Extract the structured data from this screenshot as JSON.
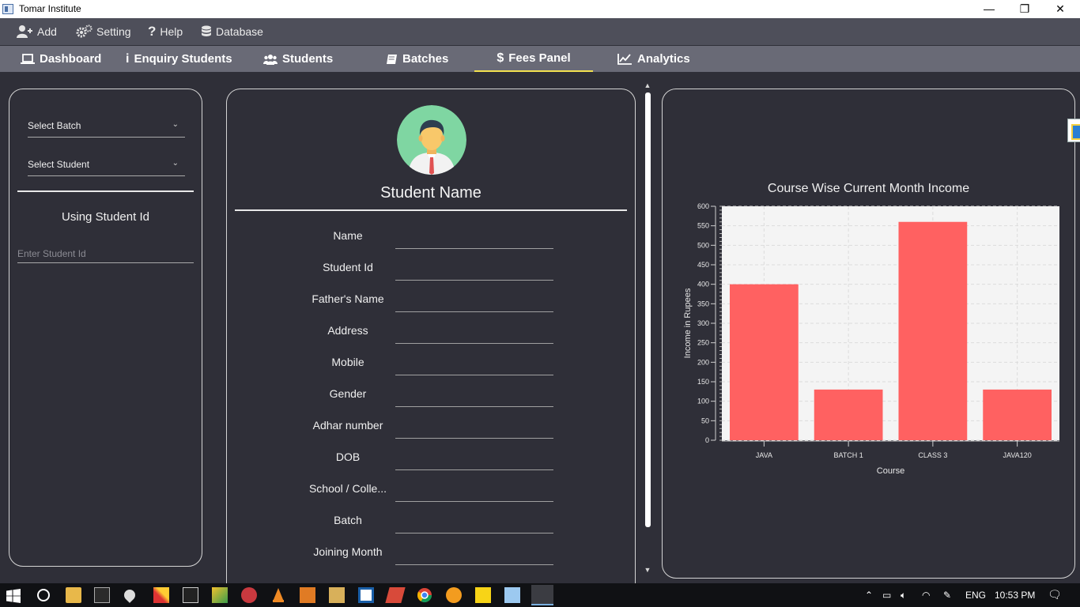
{
  "window": {
    "title": "Tomar Institute",
    "minimize": "—",
    "restore": "❐",
    "close": "✕"
  },
  "menu": [
    {
      "label": "Add",
      "icon": "add-user-icon"
    },
    {
      "label": "Setting",
      "icon": "gears-icon"
    },
    {
      "label": "Help",
      "icon": "question-icon"
    },
    {
      "label": "Database",
      "icon": "database-icon"
    }
  ],
  "tabs": [
    {
      "label": "Dashboard",
      "icon": "laptop-icon"
    },
    {
      "label": "Enquiry Students",
      "icon": "info-icon"
    },
    {
      "label": "Students",
      "icon": "users-icon"
    },
    {
      "label": "Batches",
      "icon": "book-icon"
    },
    {
      "label": "Fees Panel",
      "icon": "dollar-icon",
      "active": true
    },
    {
      "label": "Analytics",
      "icon": "line-chart-icon"
    }
  ],
  "left_panel": {
    "select_batch": "Select Batch",
    "select_student": "Select Student",
    "section_title": "Using Student Id",
    "student_id_placeholder": "Enter Student Id"
  },
  "student_panel": {
    "name_heading": "Student Name",
    "fields": [
      "Name",
      "Student Id",
      "Father's Name",
      "Address",
      "Mobile",
      "Gender",
      "Adhar number",
      "DOB",
      "School / Colle...",
      "Batch",
      "Joining Month"
    ]
  },
  "chart_data": {
    "type": "bar",
    "title": "Course Wise Current Month Income",
    "xlabel": "Course",
    "ylabel": "Income in Rupees",
    "categories": [
      "JAVA",
      "BATCH 1",
      "CLASS 3",
      "JAVA120"
    ],
    "values": [
      400,
      130,
      560,
      130
    ],
    "ylim": [
      0,
      600
    ],
    "yticks": [
      0,
      50,
      100,
      150,
      200,
      250,
      300,
      350,
      400,
      450,
      500,
      550,
      600
    ],
    "grid": true,
    "bar_color": "#ff6161",
    "plot_background": "#f4f4f4"
  },
  "taskbar": {
    "language": "ENG",
    "time": "10:53 PM"
  },
  "colors": {
    "background": "#2f2f38",
    "menubar": "#4e4f5a",
    "tabbar": "#696a76",
    "active_tab_underline": "#f3e14f"
  }
}
